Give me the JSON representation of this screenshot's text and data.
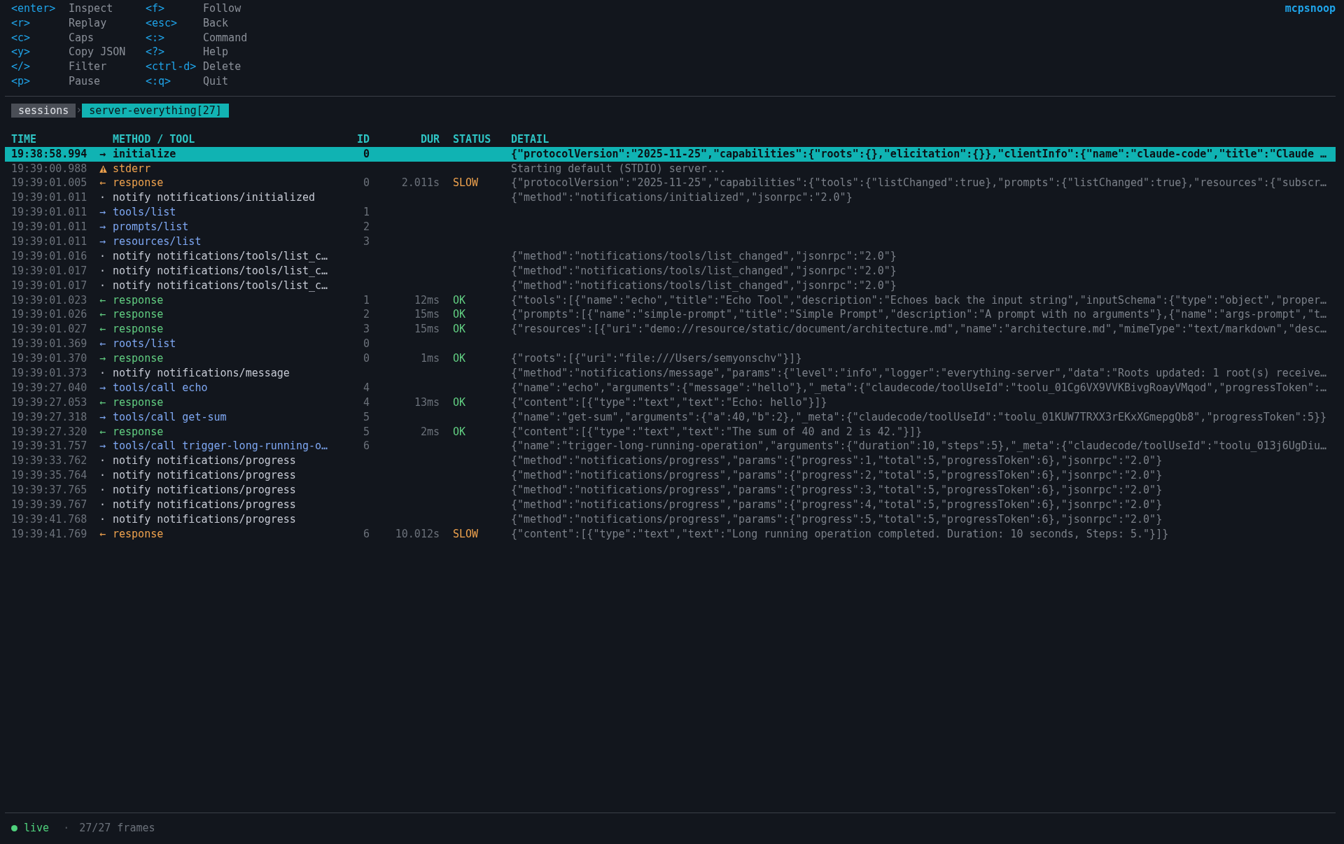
{
  "brand": "mcpsnoop",
  "keymap": {
    "columns": [
      [
        {
          "key": "<enter>",
          "label": "Inspect"
        },
        {
          "key": "<r>",
          "label": "Replay"
        },
        {
          "key": "<c>",
          "label": "Caps"
        },
        {
          "key": "<y>",
          "label": "Copy JSON"
        },
        {
          "key": "</>",
          "label": "Filter"
        },
        {
          "key": "<p>",
          "label": "Pause"
        }
      ],
      [
        {
          "key": "<f>",
          "label": "Follow"
        },
        {
          "key": "<esc>",
          "label": "Back"
        },
        {
          "key": "<:>",
          "label": "Command"
        },
        {
          "key": "<?>",
          "label": "Help"
        },
        {
          "key": "<ctrl-d>",
          "label": "Delete"
        },
        {
          "key": "<:q>",
          "label": "Quit"
        }
      ]
    ]
  },
  "breadcrumb": {
    "separator": "›",
    "items": [
      {
        "label": "sessions",
        "selected": false
      },
      {
        "label": "server-everything[27]",
        "selected": true
      }
    ]
  },
  "table": {
    "columns": [
      "TIME",
      "METHOD / TOOL",
      "ID",
      "DUR",
      "STATUS",
      "DETAIL"
    ],
    "rows": [
      {
        "time": "19:38:58.994",
        "kind": "request",
        "arrow": "→",
        "method": "initialize",
        "id": "0",
        "detail": "{\"protocolVersion\":\"2025-11-25\",\"capabilities\":{\"roots\":{},\"elicitation\":{}},\"clientInfo\":{\"name\":\"claude-code\",\"title\":\"Claude …",
        "selected": true
      },
      {
        "time": "19:39:00.988",
        "kind": "stderr",
        "method": "stderr",
        "detail": "Starting default (STDIO) server...",
        "selected": false
      },
      {
        "time": "19:39:01.005",
        "kind": "response",
        "arrow": "←",
        "method": "response",
        "id": "0",
        "duration": "2.011s",
        "status": "SLOW",
        "slow": true,
        "detail": "{\"protocolVersion\":\"2025-11-25\",\"capabilities\":{\"tools\":{\"listChanged\":true},\"prompts\":{\"listChanged\":true},\"resources\":{\"subscr…",
        "selected": false
      },
      {
        "time": "19:39:01.011",
        "kind": "notify",
        "arrow": "·",
        "method": "notify notifications/initialized",
        "detail": "{\"method\":\"notifications/initialized\",\"jsonrpc\":\"2.0\"}",
        "selected": false
      },
      {
        "time": "19:39:01.011",
        "kind": "request",
        "arrow": "→",
        "method": "tools/list",
        "id": "1",
        "selected": false
      },
      {
        "time": "19:39:01.011",
        "kind": "request",
        "arrow": "→",
        "method": "prompts/list",
        "id": "2",
        "selected": false
      },
      {
        "time": "19:39:01.011",
        "kind": "request",
        "arrow": "→",
        "method": "resources/list",
        "id": "3",
        "selected": false
      },
      {
        "time": "19:39:01.016",
        "kind": "notify",
        "arrow": "·",
        "method": "notify notifications/tools/list_c…",
        "detail": "{\"method\":\"notifications/tools/list_changed\",\"jsonrpc\":\"2.0\"}",
        "selected": false
      },
      {
        "time": "19:39:01.017",
        "kind": "notify",
        "arrow": "·",
        "method": "notify notifications/tools/list_c…",
        "detail": "{\"method\":\"notifications/tools/list_changed\",\"jsonrpc\":\"2.0\"}",
        "selected": false
      },
      {
        "time": "19:39:01.017",
        "kind": "notify",
        "arrow": "·",
        "method": "notify notifications/tools/list_c…",
        "detail": "{\"method\":\"notifications/tools/list_changed\",\"jsonrpc\":\"2.0\"}",
        "selected": false
      },
      {
        "time": "19:39:01.023",
        "kind": "response",
        "arrow": "←",
        "method": "response",
        "id": "1",
        "duration": "12ms",
        "status": "OK",
        "slow": false,
        "detail": "{\"tools\":[{\"name\":\"echo\",\"title\":\"Echo Tool\",\"description\":\"Echoes back the input string\",\"inputSchema\":{\"type\":\"object\",\"proper…",
        "selected": false
      },
      {
        "time": "19:39:01.026",
        "kind": "response",
        "arrow": "←",
        "method": "response",
        "id": "2",
        "duration": "15ms",
        "status": "OK",
        "slow": false,
        "detail": "{\"prompts\":[{\"name\":\"simple-prompt\",\"title\":\"Simple Prompt\",\"description\":\"A prompt with no arguments\"},{\"name\":\"args-prompt\",\"t…",
        "selected": false
      },
      {
        "time": "19:39:01.027",
        "kind": "response",
        "arrow": "←",
        "method": "response",
        "id": "3",
        "duration": "15ms",
        "status": "OK",
        "slow": false,
        "detail": "{\"resources\":[{\"uri\":\"demo://resource/static/document/architecture.md\",\"name\":\"architecture.md\",\"mimeType\":\"text/markdown\",\"desc…",
        "selected": false
      },
      {
        "time": "19:39:01.369",
        "kind": "request",
        "arrow": "←",
        "method": "roots/list",
        "id": "0",
        "selected": false
      },
      {
        "time": "19:39:01.370",
        "kind": "response",
        "arrow": "→",
        "method": "response",
        "id": "0",
        "duration": "1ms",
        "status": "OK",
        "slow": false,
        "detail": "{\"roots\":[{\"uri\":\"file:///Users/semyonschv\"}]}",
        "selected": false
      },
      {
        "time": "19:39:01.373",
        "kind": "notify",
        "arrow": "·",
        "method": "notify notifications/message",
        "detail": "{\"method\":\"notifications/message\",\"params\":{\"level\":\"info\",\"logger\":\"everything-server\",\"data\":\"Roots updated: 1 root(s) receive…",
        "selected": false
      },
      {
        "time": "19:39:27.040",
        "kind": "request",
        "arrow": "→",
        "method": "tools/call echo",
        "id": "4",
        "detail": "{\"name\":\"echo\",\"arguments\":{\"message\":\"hello\"},\"_meta\":{\"claudecode/toolUseId\":\"toolu_01Cg6VX9VVKBivgRoayVMqod\",\"progressToken\":…",
        "selected": false
      },
      {
        "time": "19:39:27.053",
        "kind": "response",
        "arrow": "←",
        "method": "response",
        "id": "4",
        "duration": "13ms",
        "status": "OK",
        "slow": false,
        "detail": "{\"content\":[{\"type\":\"text\",\"text\":\"Echo: hello\"}]}",
        "selected": false
      },
      {
        "time": "19:39:27.318",
        "kind": "request",
        "arrow": "→",
        "method": "tools/call get-sum",
        "id": "5",
        "detail": "{\"name\":\"get-sum\",\"arguments\":{\"a\":40,\"b\":2},\"_meta\":{\"claudecode/toolUseId\":\"toolu_01KUW7TRXX3rEKxXGmepgQb8\",\"progressToken\":5}}",
        "selected": false
      },
      {
        "time": "19:39:27.320",
        "kind": "response",
        "arrow": "←",
        "method": "response",
        "id": "5",
        "duration": "2ms",
        "status": "OK",
        "slow": false,
        "detail": "{\"content\":[{\"type\":\"text\",\"text\":\"The sum of 40 and 2 is 42.\"}]}",
        "selected": false
      },
      {
        "time": "19:39:31.757",
        "kind": "request",
        "arrow": "→",
        "method": "tools/call trigger-long-running-o…",
        "id": "6",
        "detail": "{\"name\":\"trigger-long-running-operation\",\"arguments\":{\"duration\":10,\"steps\":5},\"_meta\":{\"claudecode/toolUseId\":\"toolu_013j6UgDiu…",
        "selected": false
      },
      {
        "time": "19:39:33.762",
        "kind": "notify",
        "arrow": "·",
        "method": "notify notifications/progress",
        "detail": "{\"method\":\"notifications/progress\",\"params\":{\"progress\":1,\"total\":5,\"progressToken\":6},\"jsonrpc\":\"2.0\"}",
        "selected": false
      },
      {
        "time": "19:39:35.764",
        "kind": "notify",
        "arrow": "·",
        "method": "notify notifications/progress",
        "detail": "{\"method\":\"notifications/progress\",\"params\":{\"progress\":2,\"total\":5,\"progressToken\":6},\"jsonrpc\":\"2.0\"}",
        "selected": false
      },
      {
        "time": "19:39:37.765",
        "kind": "notify",
        "arrow": "·",
        "method": "notify notifications/progress",
        "detail": "{\"method\":\"notifications/progress\",\"params\":{\"progress\":3,\"total\":5,\"progressToken\":6},\"jsonrpc\":\"2.0\"}",
        "selected": false
      },
      {
        "time": "19:39:39.767",
        "kind": "notify",
        "arrow": "·",
        "method": "notify notifications/progress",
        "detail": "{\"method\":\"notifications/progress\",\"params\":{\"progress\":4,\"total\":5,\"progressToken\":6},\"jsonrpc\":\"2.0\"}",
        "selected": false
      },
      {
        "time": "19:39:41.768",
        "kind": "notify",
        "arrow": "·",
        "method": "notify notifications/progress",
        "detail": "{\"method\":\"notifications/progress\",\"params\":{\"progress\":5,\"total\":5,\"progressToken\":6},\"jsonrpc\":\"2.0\"}",
        "selected": false
      },
      {
        "time": "19:39:41.769",
        "kind": "response",
        "arrow": "←",
        "method": "response",
        "id": "6",
        "duration": "10.012s",
        "status": "SLOW",
        "slow": true,
        "detail": "{\"content\":[{\"type\":\"text\",\"text\":\"Long running operation completed. Duration: 10 seconds, Steps: 5.\"}]}",
        "selected": false
      }
    ]
  },
  "status_bar": {
    "live": true,
    "mode": "live",
    "separator": "·",
    "frames": "27/27 frames"
  }
}
